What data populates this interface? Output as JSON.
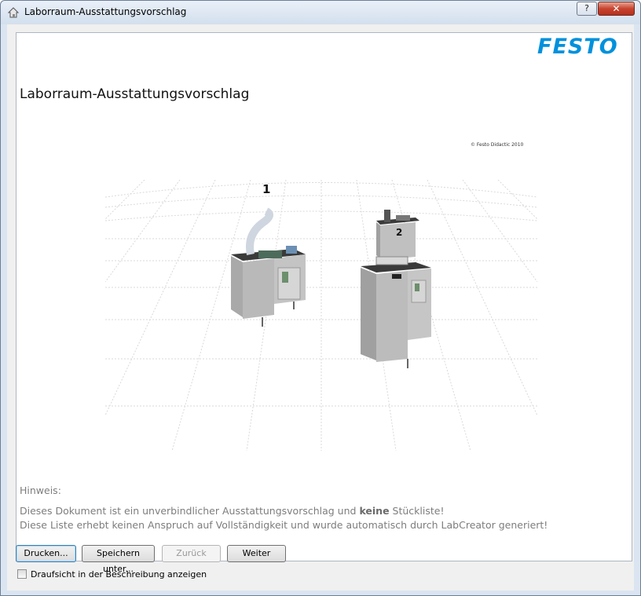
{
  "window": {
    "title": "Laborraum-Ausstattungsvorschlag",
    "help_label": "?",
    "close_label": "✕"
  },
  "document": {
    "brand": "FESTO",
    "title": "Laborraum-Ausstattungsvorschlag",
    "copyright": "© Festo Didactic 2010",
    "station_labels": [
      "1",
      "2"
    ],
    "hint_heading": "Hinweis:",
    "hint_line1_before": "Dieses Dokument ist ein unverbindlicher Ausstattungsvorschlag und ",
    "hint_line1_bold": "keine",
    "hint_line1_after": " Stückliste!",
    "hint_line2": "Diese Liste erhebt keinen Anspruch auf Vollständigkeit und wurde automatisch durch LabCreator generiert!"
  },
  "buttons": {
    "print": "Drucken...",
    "save_as": "Speichern unter...",
    "back": "Zurück",
    "next": "Weiter"
  },
  "options": {
    "top_view_label": "Draufsicht in der Beschreibung anzeigen",
    "top_view_checked": false
  },
  "colors": {
    "brand": "#0091dc",
    "titlebar": "#dbe5f1",
    "close": "#c7442f"
  }
}
